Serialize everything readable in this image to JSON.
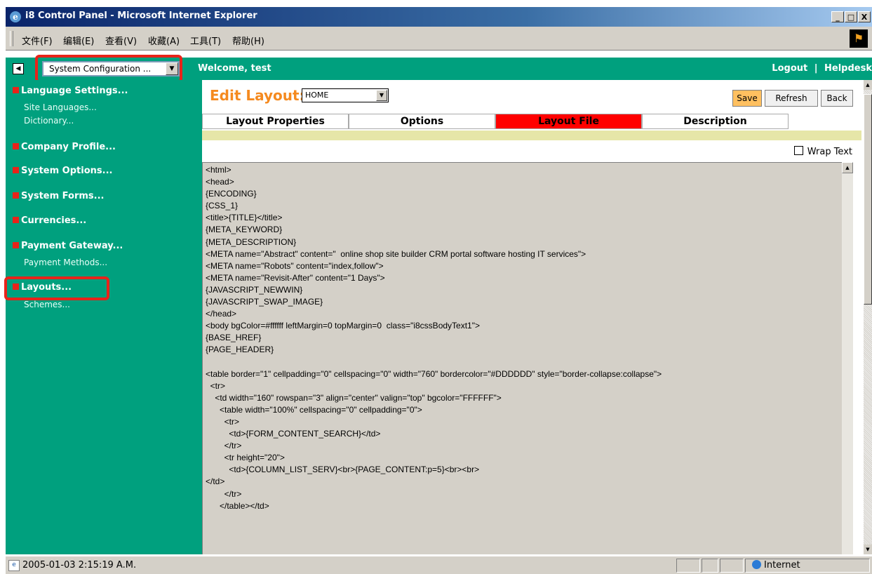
{
  "window": {
    "title": "i8 Control Panel - Microsoft Internet Explorer",
    "controls": [
      "_",
      "□",
      "X"
    ]
  },
  "menu": [
    "文件(F)",
    "编辑(E)",
    "查看(V)",
    "收藏(A)",
    "工具(T)",
    "帮助(H)"
  ],
  "topbar": {
    "back_icon": "◀",
    "module_select": "System Configuration ...",
    "welcome": "Welcome, test",
    "logout": "Logout",
    "separator": "|",
    "helpdesk": "Helpdesk"
  },
  "sidebar": {
    "sections": [
      {
        "label": "Language Settings...",
        "items": [
          "Site Languages...",
          "Dictionary..."
        ]
      },
      {
        "label": "Company Profile...",
        "items": []
      },
      {
        "label": "System Options...",
        "items": []
      },
      {
        "label": "System Forms...",
        "items": []
      },
      {
        "label": "Currencies...",
        "items": []
      },
      {
        "label": "Payment Gateway...",
        "items": [
          "Payment Methods..."
        ]
      },
      {
        "label": "Layouts...",
        "items": [
          "Schemes..."
        ]
      }
    ]
  },
  "editor": {
    "edit_label": "Edit Layout:",
    "layout_value": "HOME",
    "buttons": {
      "save": "Save",
      "refresh": "Refresh",
      "back": "Back"
    },
    "tabs": [
      "Layout Properties",
      "Options",
      "Layout File",
      "Description"
    ],
    "active_tab": "Layout File",
    "wrap_text": "Wrap Text",
    "code": "<html>\n<head>\n{ENCODING}\n{CSS_1}\n<title>{TITLE}</title>\n{META_KEYWORD}\n{META_DESCRIPTION}\n<META name=\"Abstract\" content=\"  online shop site builder CRM portal software hosting IT services\">\n<META name=\"Robots\" content=\"index,follow\">\n<META name=\"Revisit-After\" content=\"1 Days\">\n{JAVASCRIPT_NEWWIN}\n{JAVASCRIPT_SWAP_IMAGE}\n</head>\n<body bgColor=#ffffff leftMargin=0 topMargin=0  class=\"i8cssBodyText1\">\n{BASE_HREF}\n{PAGE_HEADER}\n\n<table border=\"1\" cellpadding=\"0\" cellspacing=\"0\" width=\"760\" bordercolor=\"#DDDDDD\" style=\"border-collapse:collapse\">\n  <tr>\n    <td width=\"160\" rowspan=\"3\" align=\"center\" valign=\"top\" bgcolor=\"FFFFFF\">\n      <table width=\"100%\" cellspacing=\"0\" cellpadding=\"0\">\n        <tr>\n          <td>{FORM_CONTENT_SEARCH}</td>\n        </tr>\n        <tr height=\"20\">\n          <td>{COLUMN_LIST_SERV}<br>{PAGE_CONTENT:p=5}<br><br>\n</td>\n        </tr>\n      </table></td>"
  },
  "status": {
    "text": "2005-01-03 2:15:19 A.M.",
    "zone": "Internet"
  },
  "colors": {
    "panel_green": "#00a07e",
    "accent_orange": "#f58a1f",
    "active_tab_red": "#ff0000",
    "highlight_red": "#e8231a"
  }
}
